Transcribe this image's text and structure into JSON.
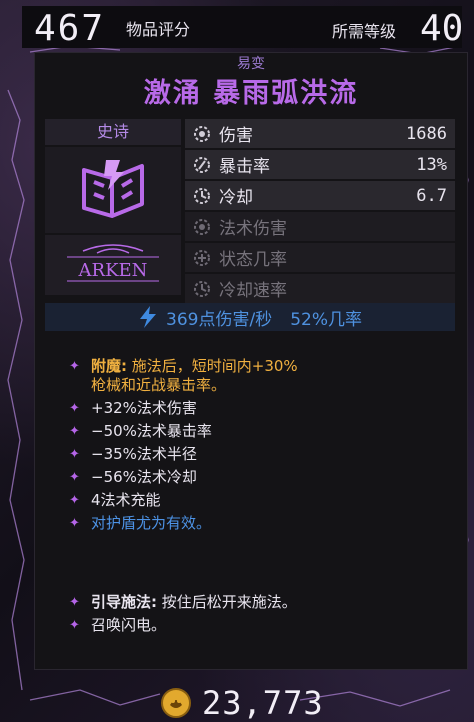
{
  "header": {
    "gear_score": "467",
    "gear_score_label": "物品评分",
    "required_level_label": "所需等级",
    "required_level": "40"
  },
  "item": {
    "manufacturer_line": "易变",
    "name": "激涌 暴雨弧洪流",
    "rarity": "史诗",
    "rarity_color": "#b48ae6",
    "icon": "spellbook-icon",
    "brand": "ARKEN"
  },
  "stats": [
    {
      "label": "伤害",
      "value": "1686",
      "icon": "damage-gear-icon",
      "active": true
    },
    {
      "label": "暴击率",
      "value": "13%",
      "icon": "crit-gear-icon",
      "active": true
    },
    {
      "label": "冷却",
      "value": "6.7",
      "icon": "cooldown-gear-icon",
      "active": true
    },
    {
      "label": "法术伤害",
      "value": "",
      "icon": "spell-damage-gear-icon",
      "active": false
    },
    {
      "label": "状态几率",
      "value": "",
      "icon": "status-gear-icon",
      "active": false
    },
    {
      "label": "冷却速率",
      "value": "",
      "icon": "cooldown-rate-gear-icon",
      "active": false
    }
  ],
  "dps": {
    "damage_per_second": "369点伤害/秒",
    "chance": "52%几率",
    "icon": "lightning-icon"
  },
  "enchant": {
    "name": "附魔:",
    "text": "施法后，短时间内+30%",
    "text2": "枪械和近战暴击率。"
  },
  "effects": [
    {
      "text": "+32%法术伤害",
      "color": "white"
    },
    {
      "text": "−50%法术暴击率",
      "color": "white"
    },
    {
      "text": "−35%法术半径",
      "color": "white"
    },
    {
      "text": "−56%法术冷却",
      "color": "white"
    },
    {
      "text": "4法术充能",
      "color": "white"
    },
    {
      "text": "对护盾尤为有效。",
      "color": "blue"
    }
  ],
  "channel": {
    "name": "引导施法:",
    "text": "按住后松开来施法。",
    "line2": "召唤闪电。"
  },
  "footer": {
    "price": "23,773",
    "icon": "gold-coin-icon"
  },
  "colors": {
    "epic_purple": "#b86ae8",
    "enchant_gold": "#f0b040",
    "info_blue": "#4d93e6"
  }
}
